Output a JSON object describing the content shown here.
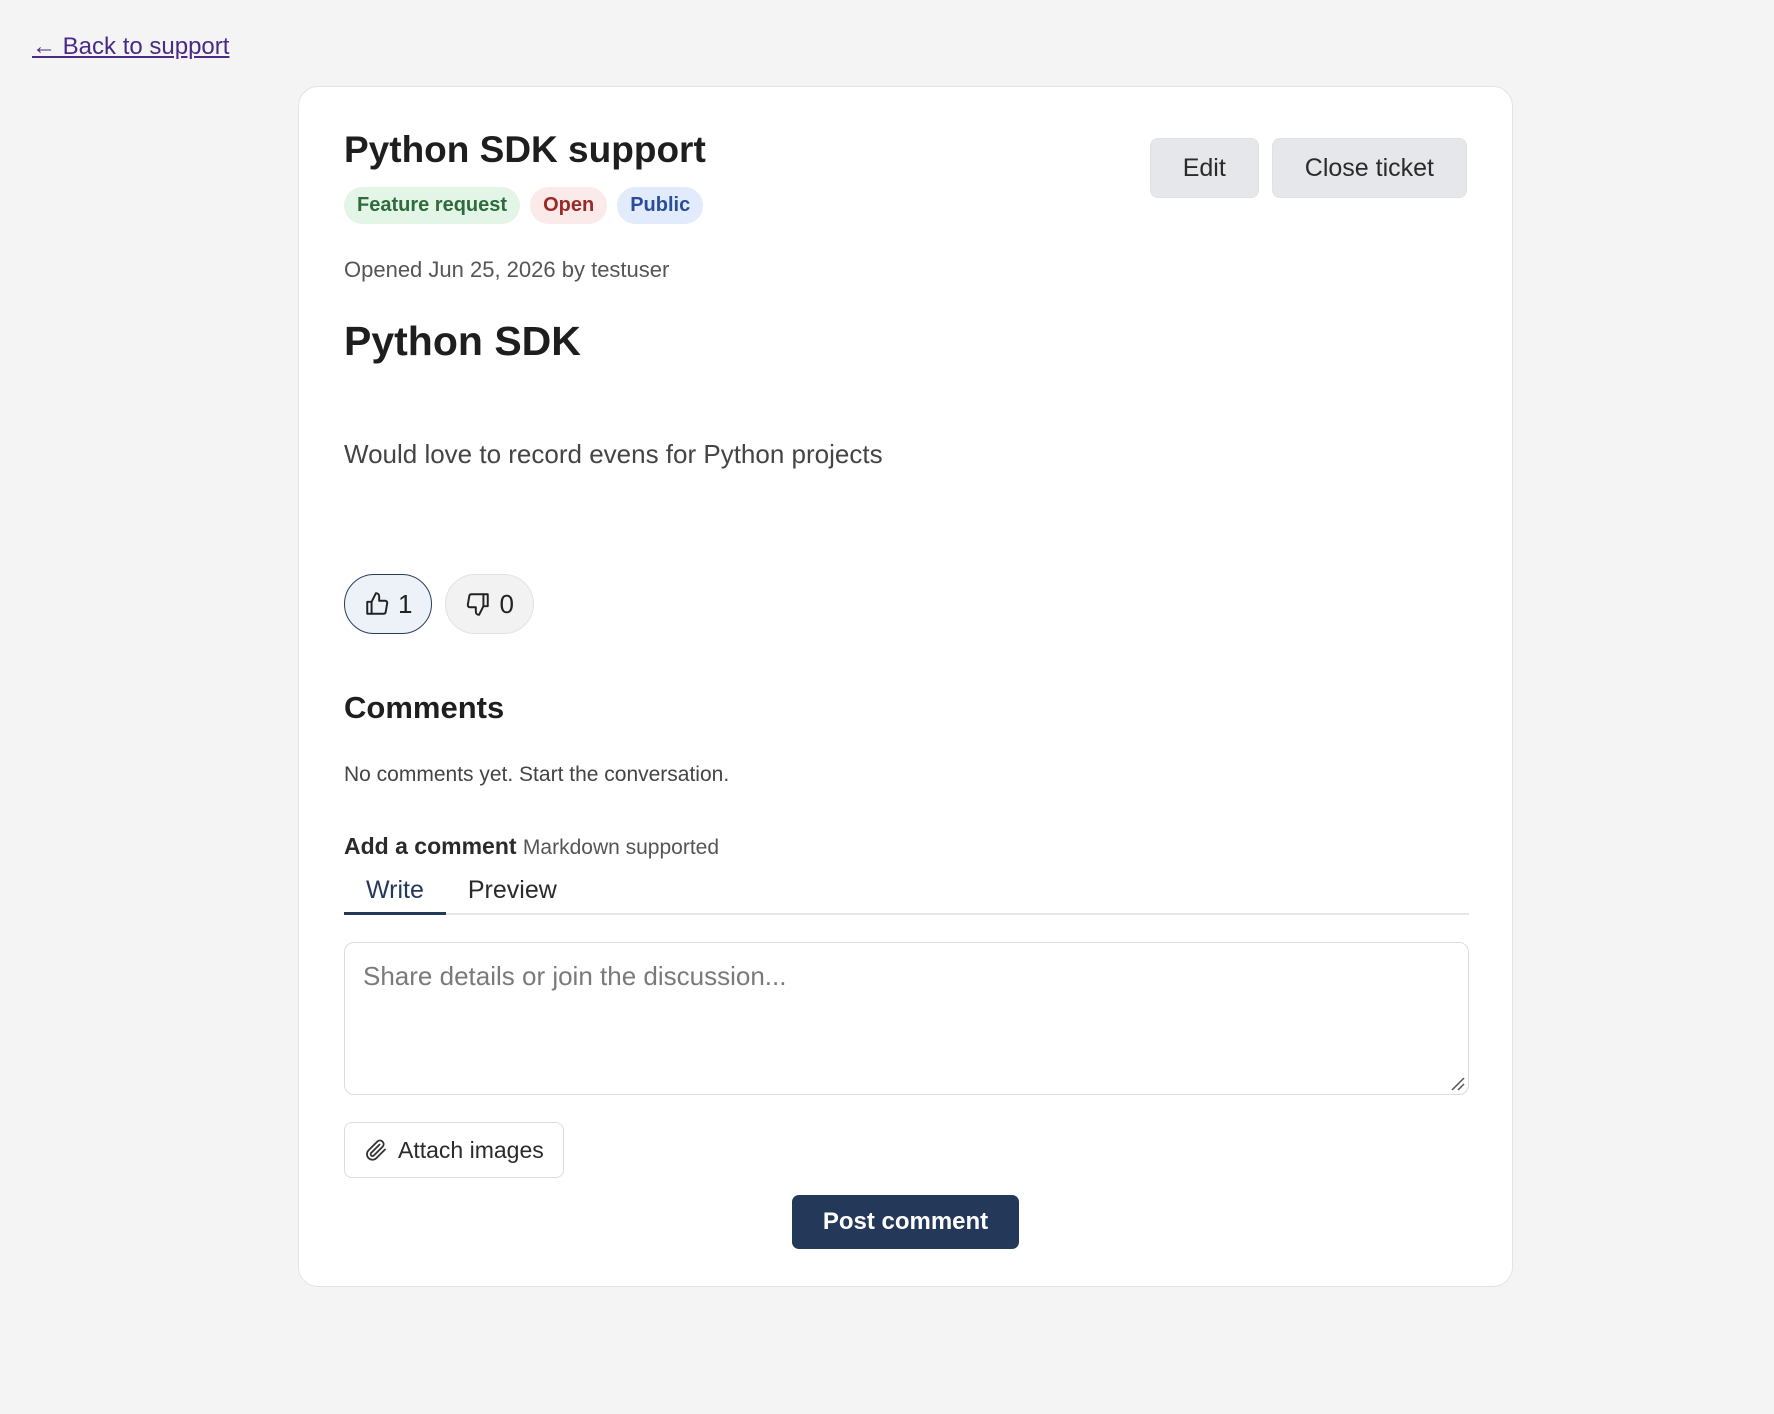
{
  "nav": {
    "back_label": "← Back to support"
  },
  "ticket": {
    "title": "Python SDK support",
    "badges": {
      "type": "Feature request",
      "status": "Open",
      "visibility": "Public"
    },
    "actions": {
      "edit_label": "Edit",
      "close_label": "Close ticket"
    },
    "meta": "Opened Jun 25, 2026 by testuser",
    "body_heading": "Python SDK",
    "body_text": "Would love to record evens for Python projects",
    "votes": {
      "up": "1",
      "down": "0"
    },
    "icons": {
      "upvote": "thumbs-up-icon",
      "downvote": "thumbs-down-icon",
      "attach": "paperclip-icon"
    }
  },
  "comments": {
    "heading": "Comments",
    "empty_text": "No comments yet. Start the conversation.",
    "add_label": "Add a comment",
    "add_hint": "Markdown supported",
    "tabs": [
      "Write",
      "Preview"
    ],
    "active_tab": "Write",
    "placeholder": "Share details or join the discussion...",
    "value": "",
    "attach_label": "Attach images",
    "post_label": "Post comment"
  },
  "colors": {
    "accent": "#24385a",
    "link": "#4b2a86",
    "badge_type_bg": "#e2f5e6",
    "badge_status_bg": "#fbeaea",
    "badge_visibility_bg": "#e1ebfb"
  }
}
